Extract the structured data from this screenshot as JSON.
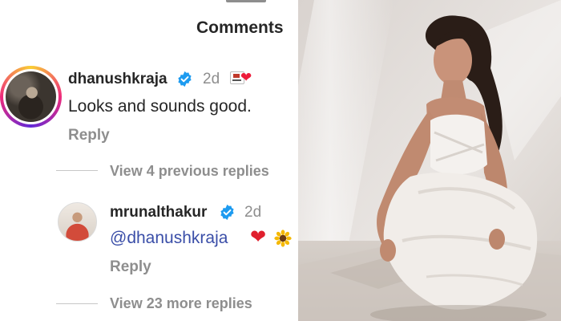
{
  "header": {
    "title": "Comments"
  },
  "comments": [
    {
      "username": "dhanushkraja",
      "time": "2d",
      "text": "Looks and sounds good.",
      "reply_label": "Reply",
      "view_replies": "View 4 previous replies",
      "badge_icon": "heart-icon"
    },
    {
      "username": "mrunalthakur",
      "time": "2d",
      "mention": "@dhanushkraja",
      "emojis": [
        "heart",
        "sunflower"
      ],
      "reply_label": "Reply",
      "view_replies": "View 23 more replies"
    }
  ],
  "colors": {
    "verified": "#1d9bf0",
    "mention": "#3a4ea8",
    "heart": "#e0202e",
    "muted": "#8e8e8e"
  }
}
